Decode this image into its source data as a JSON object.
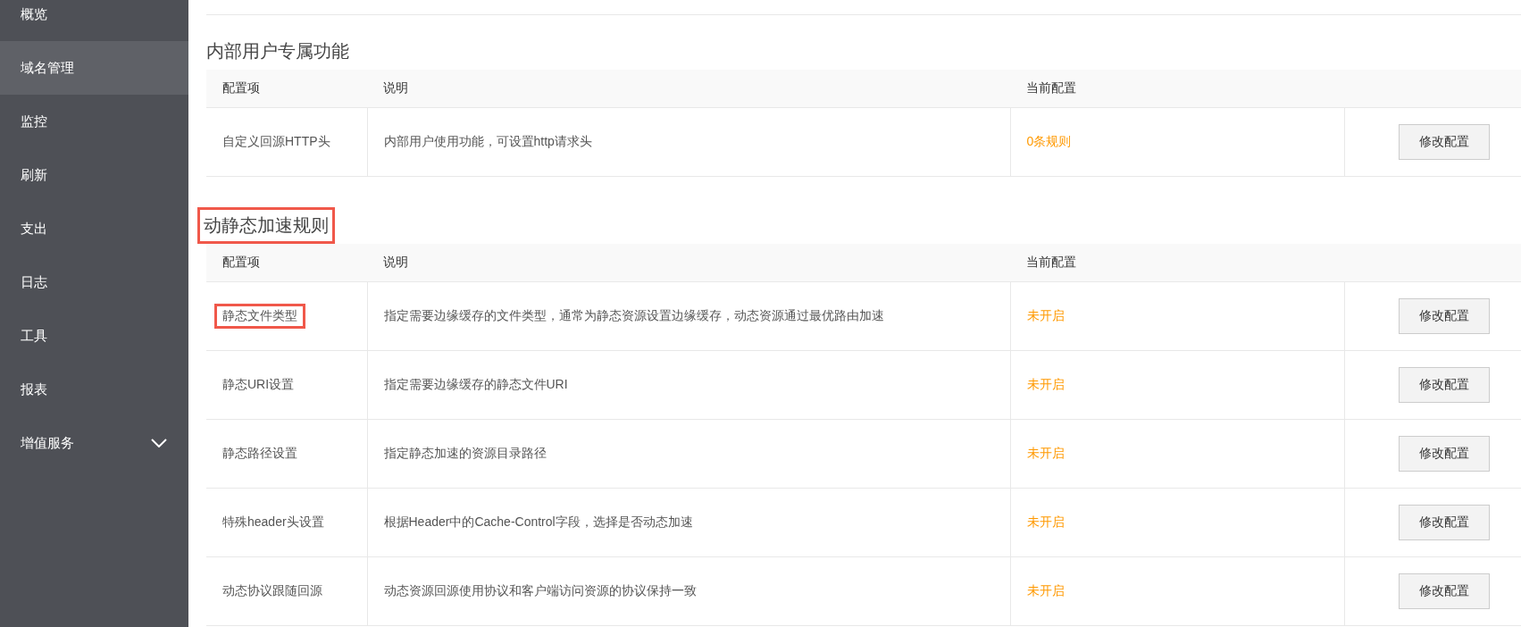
{
  "sidebar": {
    "items": [
      {
        "label": "概览",
        "selected": false,
        "kind": "link"
      },
      {
        "label": "域名管理",
        "selected": true,
        "kind": "link"
      },
      {
        "label": "监控",
        "selected": false,
        "kind": "link"
      },
      {
        "label": "刷新",
        "selected": false,
        "kind": "link"
      },
      {
        "label": "支出",
        "selected": false,
        "kind": "link"
      },
      {
        "label": "日志",
        "selected": false,
        "kind": "link"
      },
      {
        "label": "工具",
        "selected": false,
        "kind": "link"
      },
      {
        "label": "报表",
        "selected": false,
        "kind": "link"
      },
      {
        "label": "增值服务",
        "selected": false,
        "kind": "submenu"
      }
    ]
  },
  "sections": [
    {
      "title": "内部用户专属功能",
      "highlighted": false,
      "columns": [
        "配置项",
        "说明",
        "当前配置"
      ],
      "rows": [
        {
          "item": "自定义回源HTTP头",
          "highlighted": false,
          "description": "内部用户使用功能，可设置http请求头",
          "current": "0条规则",
          "button": "修改配置"
        }
      ]
    },
    {
      "title": "动静态加速规则",
      "highlighted": true,
      "columns": [
        "配置项",
        "说明",
        "当前配置"
      ],
      "rows": [
        {
          "item": "静态文件类型",
          "highlighted": true,
          "description": "指定需要边缘缓存的文件类型，通常为静态资源设置边缘缓存，动态资源通过最优路由加速",
          "current": "未开启",
          "button": "修改配置"
        },
        {
          "item": "静态URI设置",
          "highlighted": false,
          "description": "指定需要边缘缓存的静态文件URI",
          "current": "未开启",
          "button": "修改配置"
        },
        {
          "item": "静态路径设置",
          "highlighted": false,
          "description": "指定静态加速的资源目录路径",
          "current": "未开启",
          "button": "修改配置"
        },
        {
          "item": "特殊header头设置",
          "highlighted": false,
          "description": "根据Header中的Cache-Control字段，选择是否动态加速",
          "current": "未开启",
          "button": "修改配置"
        },
        {
          "item": "动态协议跟随回源",
          "highlighted": false,
          "description": "动态资源回源使用协议和客户端访问资源的协议保持一致",
          "current": "未开启",
          "button": "修改配置"
        }
      ]
    }
  ]
}
